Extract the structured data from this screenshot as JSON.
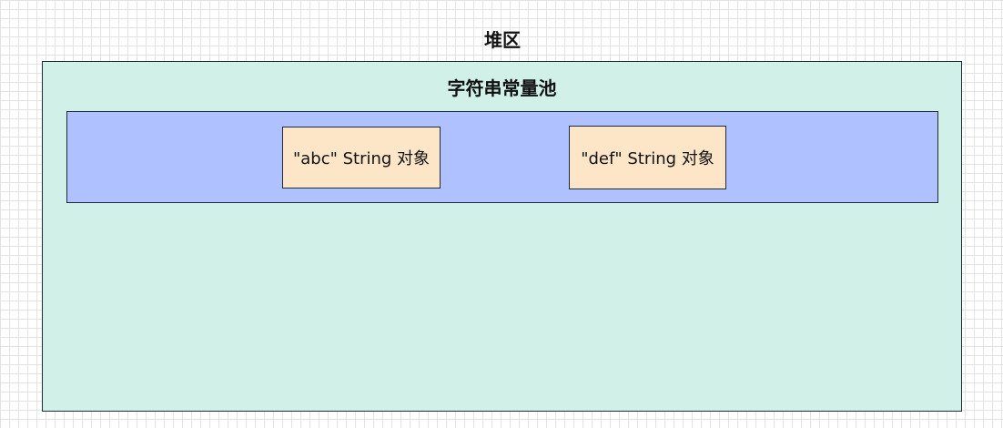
{
  "heap": {
    "title": "堆区",
    "fill": "#d0f0e8",
    "pool": {
      "title": "字符串常量池",
      "fill": "#afc2ff",
      "objects": [
        {
          "label": "\"abc\" String 对象",
          "fill": "#fde6c8"
        },
        {
          "label": "\"def\" String 对象",
          "fill": "#fde6c8"
        }
      ]
    }
  }
}
